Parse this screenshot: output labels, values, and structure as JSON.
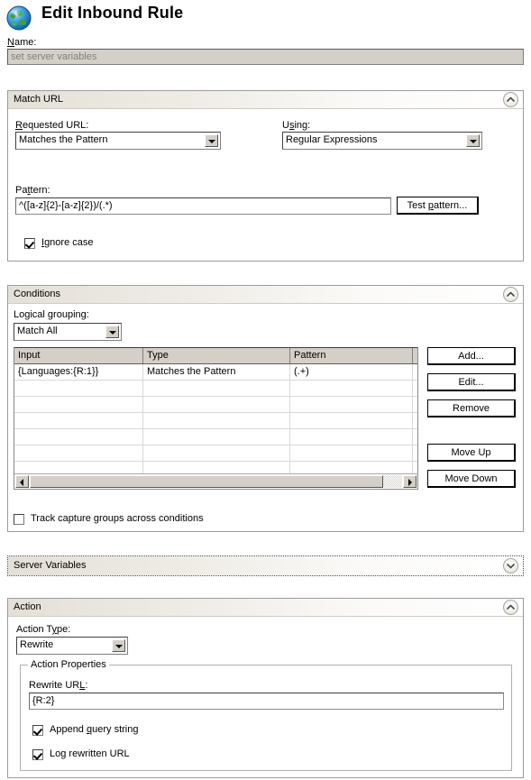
{
  "header": {
    "icon": "globe-icon",
    "title": "Edit Inbound Rule"
  },
  "name_field": {
    "label": "Name:",
    "label_accesskey": "N",
    "value": "set server variables",
    "enabled": false
  },
  "sections": {
    "match_url": {
      "title": "Match URL",
      "expanded": true,
      "collapse_icon": "chevron-up-icon",
      "requested_url": {
        "label": "Requested URL:",
        "value": "Matches the Pattern"
      },
      "using": {
        "label": "Using:",
        "value": "Regular Expressions"
      },
      "pattern": {
        "label": "Pattern:",
        "value": "^([a-z]{2}-[a-z]{2})/(.*)"
      },
      "test_pattern_button": "Test pattern...",
      "ignore_case": {
        "label": "Ignore case",
        "checked": true
      }
    },
    "conditions": {
      "title": "Conditions",
      "expanded": true,
      "collapse_icon": "chevron-up-icon",
      "logical_grouping": {
        "label": "Logical grouping:",
        "value": "Match All"
      },
      "table": {
        "columns": [
          "Input",
          "Type",
          "Pattern"
        ],
        "rows": [
          [
            "{Languages:{R:1}}",
            "Matches the Pattern",
            "(.+)"
          ],
          [
            "",
            "",
            ""
          ],
          [
            "",
            "",
            ""
          ],
          [
            "",
            "",
            ""
          ],
          [
            "",
            "",
            ""
          ],
          [
            "",
            "",
            ""
          ],
          [
            "",
            "",
            ""
          ]
        ]
      },
      "buttons": [
        "Add...",
        "Edit...",
        "Remove",
        "Move Up",
        "Move Down"
      ],
      "track_capture_groups": {
        "label": "Track capture groups across conditions",
        "checked": false
      }
    },
    "server_variables": {
      "title": "Server Variables",
      "expanded": false,
      "collapse_icon": "chevron-down-icon",
      "focused": true
    },
    "action": {
      "title": "Action",
      "expanded": true,
      "collapse_icon": "chevron-up-icon",
      "action_type": {
        "label": "Action Type:",
        "value": "Rewrite"
      },
      "action_properties": {
        "title": "Action Properties",
        "rewrite_url": {
          "label": "Rewrite URL:",
          "value": "{R:2}"
        },
        "append_query_string": {
          "label": "Append query string",
          "checked": true
        },
        "log_rewritten_url": {
          "label": "Log rewritten URL",
          "checked": true
        }
      }
    }
  },
  "colors": {
    "panel_border": "#9d9d9d",
    "header_gradient_start": "#e4e0d8",
    "disabled_field_bg": "#d4d0c8",
    "disabled_text": "#808080"
  }
}
